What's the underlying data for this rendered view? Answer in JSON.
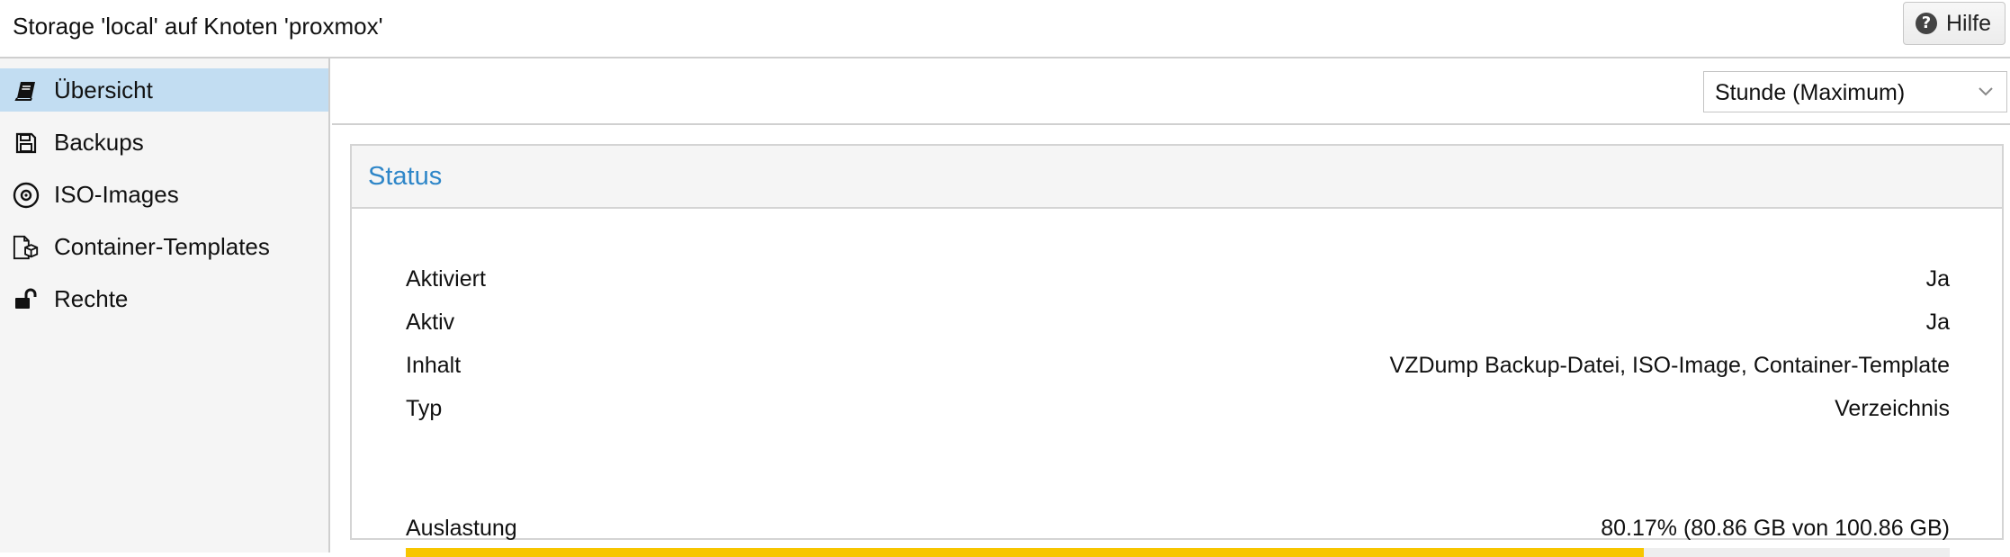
{
  "window": {
    "title": "Storage 'local' auf Knoten 'proxmox'",
    "help_label": "Hilfe",
    "help_icon": "question-circle-icon"
  },
  "sidebar": {
    "items": [
      {
        "label": "Übersicht",
        "icon": "book-icon",
        "active": true
      },
      {
        "label": "Backups",
        "icon": "floppy-disk-icon",
        "active": false
      },
      {
        "label": "ISO-Images",
        "icon": "disc-icon",
        "active": false
      },
      {
        "label": "Container-Templates",
        "icon": "file-cube-icon",
        "active": false
      },
      {
        "label": "Rechte",
        "icon": "unlock-icon",
        "active": false
      }
    ]
  },
  "toolbar": {
    "timeframe_value": "Stunde (Maximum)"
  },
  "status": {
    "title": "Status",
    "rows": [
      {
        "key": "Aktiviert",
        "value": "Ja"
      },
      {
        "key": "Aktiv",
        "value": "Ja"
      },
      {
        "key": "Inhalt",
        "value": "VZDump Backup-Datei, ISO-Image, Container-Template"
      },
      {
        "key": "Typ",
        "value": "Verzeichnis"
      }
    ],
    "usage": {
      "label": "Auslastung",
      "value": "80.17% (80.86 GB von 100.86 GB)",
      "fraction": 0.8017
    }
  },
  "colors": {
    "accent": "#2e86c8",
    "selection": "#c2ddf2",
    "usage_bar": "#f7c600"
  }
}
